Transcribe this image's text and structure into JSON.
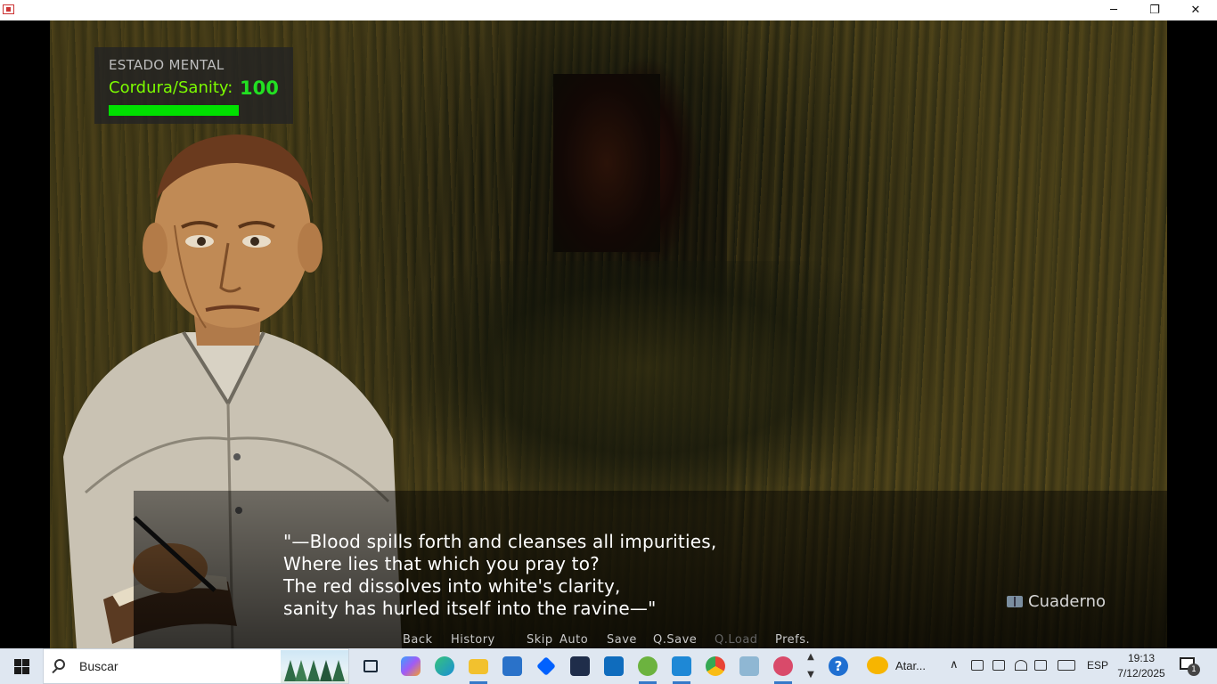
{
  "window": {
    "minimize_glyph": "─",
    "maximize_glyph": "❐",
    "close_glyph": "✕"
  },
  "hud": {
    "title": "ESTADO MENTAL",
    "sanity_label": "Cordura/Sanity:",
    "sanity_value": "100",
    "sanity_fraction": 1.0,
    "bar_color": "#00e000"
  },
  "dialogue": {
    "lines": [
      "\"—Blood spills forth and cleanses all impurities,",
      "Where lies that which you pray to?",
      "The red dissolves into white's clarity,",
      "sanity has hurled itself into the ravine—\""
    ]
  },
  "notebook": {
    "label": "Cuaderno",
    "icon": "book-icon"
  },
  "quick_menu": {
    "back": "Back",
    "history": "History",
    "skip": "Skip",
    "auto": "Auto",
    "save": "Save",
    "qsave": "Q.Save",
    "qload": "Q.Load",
    "prefs": "Prefs."
  },
  "taskbar": {
    "search_placeholder": "Buscar",
    "apps": [
      {
        "name": "task-view",
        "color": "#1b2a3a"
      },
      {
        "name": "copilot",
        "color": "#7a5af5"
      },
      {
        "name": "edge",
        "color": "#1a8fd6"
      },
      {
        "name": "file-explorer",
        "color": "#f2c12e"
      },
      {
        "name": "microsoft-store",
        "color": "#2a72c9"
      },
      {
        "name": "dropbox",
        "color": "#0061fe"
      },
      {
        "name": "powershell-app",
        "color": "#1f2d4a"
      },
      {
        "name": "outlook",
        "color": "#0f6cbd"
      },
      {
        "name": "utorrent",
        "color": "#6cb33f"
      },
      {
        "name": "vscode",
        "color": "#1e88d6"
      },
      {
        "name": "chrome",
        "color": "#e84335"
      },
      {
        "name": "notepad",
        "color": "#8fb7d3"
      },
      {
        "name": "game-app",
        "color": "#d94a6a"
      }
    ],
    "weather_text": "Atar...",
    "language": "ESP",
    "time": "19:13",
    "date": "7/12/2025",
    "notifications_count": "1"
  }
}
